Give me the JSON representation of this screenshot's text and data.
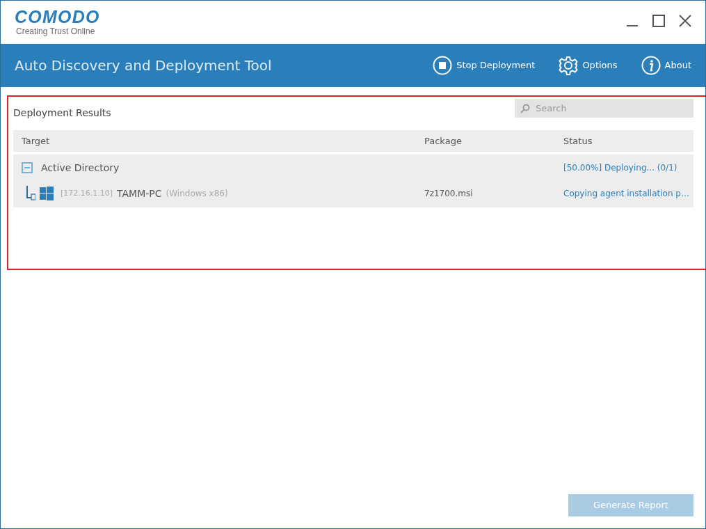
{
  "window": {
    "logo": "COMODO",
    "tagline": "Creating Trust Online"
  },
  "toolbar": {
    "title": "Auto Discovery and Deployment Tool",
    "buttons": [
      {
        "kind": "stop",
        "label": "Stop Deployment"
      },
      {
        "kind": "options",
        "label": "Options"
      },
      {
        "kind": "about",
        "label": "About"
      }
    ]
  },
  "results": {
    "title": "Deployment Results",
    "search": {
      "placeholder": "Search"
    },
    "columns": [
      "Target",
      "Package",
      "Status"
    ],
    "rows": [
      {
        "target": "Active Directory",
        "expanded": true,
        "status": "[50.00%] Deploying... (0/1)",
        "children": [
          {
            "ip": "[172.16.1.10]",
            "name": "TAMM-PC",
            "os": "(Windows x86)",
            "package": "7z1700.msi",
            "status": "Copying agent installation p…"
          }
        ]
      }
    ]
  },
  "generate_button": {
    "label": "Generate Report",
    "disabled": true
  }
}
